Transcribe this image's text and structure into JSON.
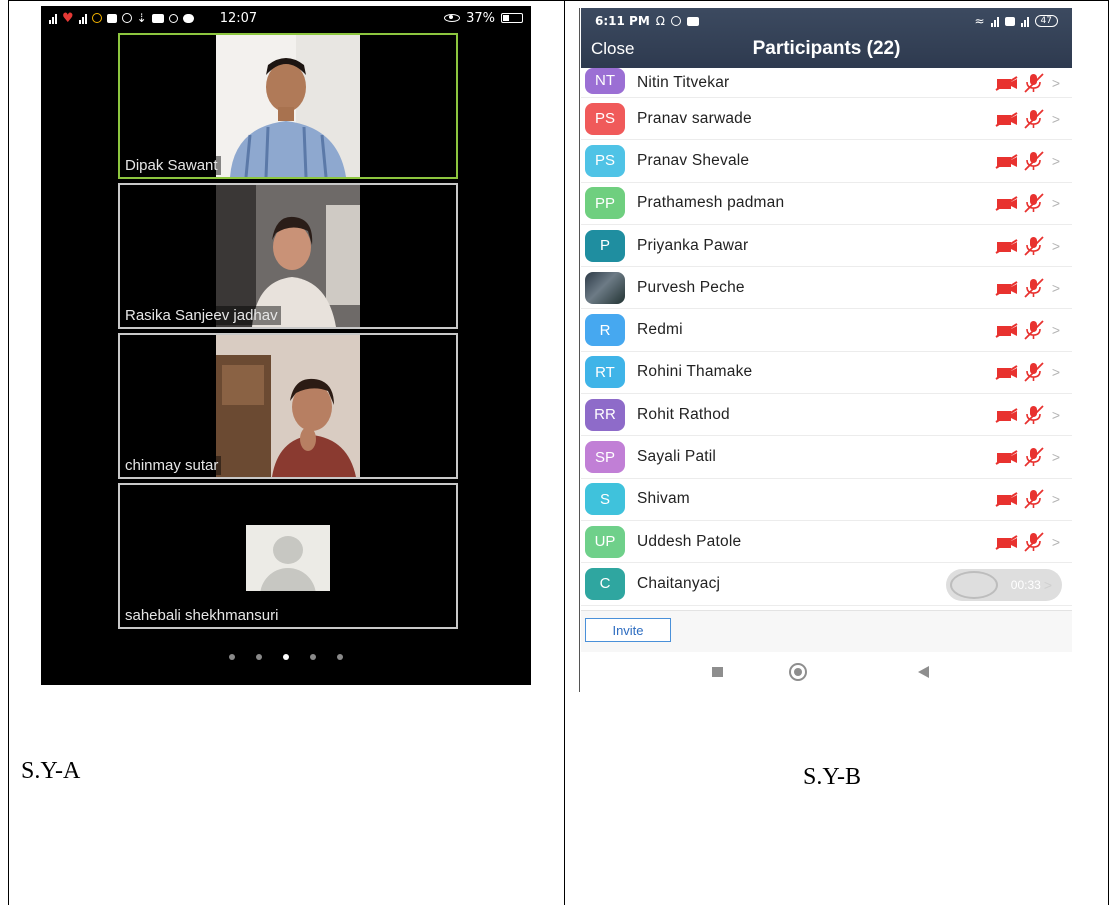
{
  "captions": {
    "left": "S.Y-A",
    "right": "S.Y-B"
  },
  "left_phone": {
    "status_time": "12:07",
    "status_battery": "37%",
    "tiles": [
      {
        "name": "Dipak Sawant",
        "active": true
      },
      {
        "name": "Rasika Sanjeev jadhav",
        "active": false
      },
      {
        "name": "chinmay sutar",
        "active": false
      },
      {
        "name": "sahebali shekhmansuri",
        "active": false
      }
    ],
    "page_count": 5,
    "active_page": 3
  },
  "right_phone": {
    "status_time": "6:11 PM",
    "status_battery": "47",
    "close_label": "Close",
    "title": "Participants (22)",
    "participants": [
      {
        "initials": "NT",
        "name": "Nitin Titvekar",
        "color": "#9b6fd4"
      },
      {
        "initials": "PS",
        "name": "Pranav sarwade",
        "color": "#f05a5a"
      },
      {
        "initials": "PS",
        "name": "Pranav Shevale",
        "color": "#4fc3e6"
      },
      {
        "initials": "PP",
        "name": "Prathamesh padman",
        "color": "#6fcf7f"
      },
      {
        "initials": "P",
        "name": "Priyanka Pawar",
        "color": "#1f8ea0"
      },
      {
        "initials": "",
        "name": "Purvesh Peche",
        "color": "#3e4a55",
        "photo": true
      },
      {
        "initials": "R",
        "name": "Redmi",
        "color": "#46a8f0"
      },
      {
        "initials": "RT",
        "name": "Rohini Thamake",
        "color": "#3fb4e8"
      },
      {
        "initials": "RR",
        "name": "Rohit Rathod",
        "color": "#8e6bc9"
      },
      {
        "initials": "SP",
        "name": "Sayali Patil",
        "color": "#c17fd6"
      },
      {
        "initials": "S",
        "name": "Shivam",
        "color": "#3fc2dc"
      },
      {
        "initials": "UP",
        "name": "Uddesh Patole",
        "color": "#6fd08a"
      },
      {
        "initials": "C",
        "name": "Chaitanyacj",
        "color": "#2fa6a0"
      }
    ],
    "timer": "00:33",
    "invite_label": "Invite",
    "muted_color": "#e8322f"
  }
}
